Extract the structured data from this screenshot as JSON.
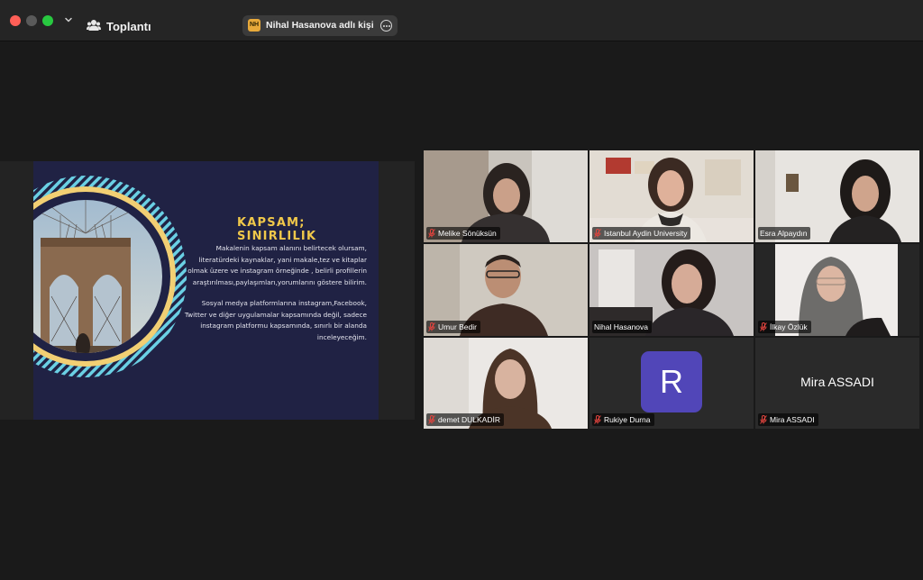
{
  "window": {
    "title": "Toplantı",
    "notification": {
      "badge": "NH",
      "text": "Nihal Hasanova adlı kişinin ekran paylaşımını görüntülüyorsunuz"
    }
  },
  "slide": {
    "title": "KAPSAM; SINIRLILIK",
    "paragraph1": "Makalenin kapsam alanını belirtecek olursam, literatürdeki kaynaklar, yani makale,tez ve kitaplar olmak üzere ve instagram örneğinde , belirli profillerin araştırılması,paylaşımları,yorumlarını göstere bilirim.",
    "paragraph2": "Sosyal medya platformlarına instagram,Facebook, Twitter ve diğer uygulamalar kapsamında değil, sadece instagram platformu kapsamında, sınırlı bir alanda inceleyeceğim."
  },
  "participants": [
    {
      "name": "Melike Sönüksün",
      "muted": true
    },
    {
      "name": "Istanbul Aydin University",
      "muted": true
    },
    {
      "name": "Esra Alpaydın",
      "muted": false
    },
    {
      "name": "Umur Bedir",
      "muted": true
    },
    {
      "name": "Nihal Hasanova",
      "muted": false,
      "active_speaker": true
    },
    {
      "name": "İlkay Özlük",
      "muted": true
    },
    {
      "name": "demet DULKADİR",
      "muted": true
    },
    {
      "name": "Rukiye Durna",
      "muted": true,
      "avatar_letter": "R"
    },
    {
      "name": "Mira ASSADI",
      "muted": true,
      "display_name": "Mira ASSADI"
    }
  ],
  "colors": {
    "active_speaker_border": "#3dc35b",
    "muted_icon": "#e0443e",
    "avatar_bg": "#5146b8",
    "slide_bg": "#202244",
    "slide_title": "#f0c84a"
  }
}
